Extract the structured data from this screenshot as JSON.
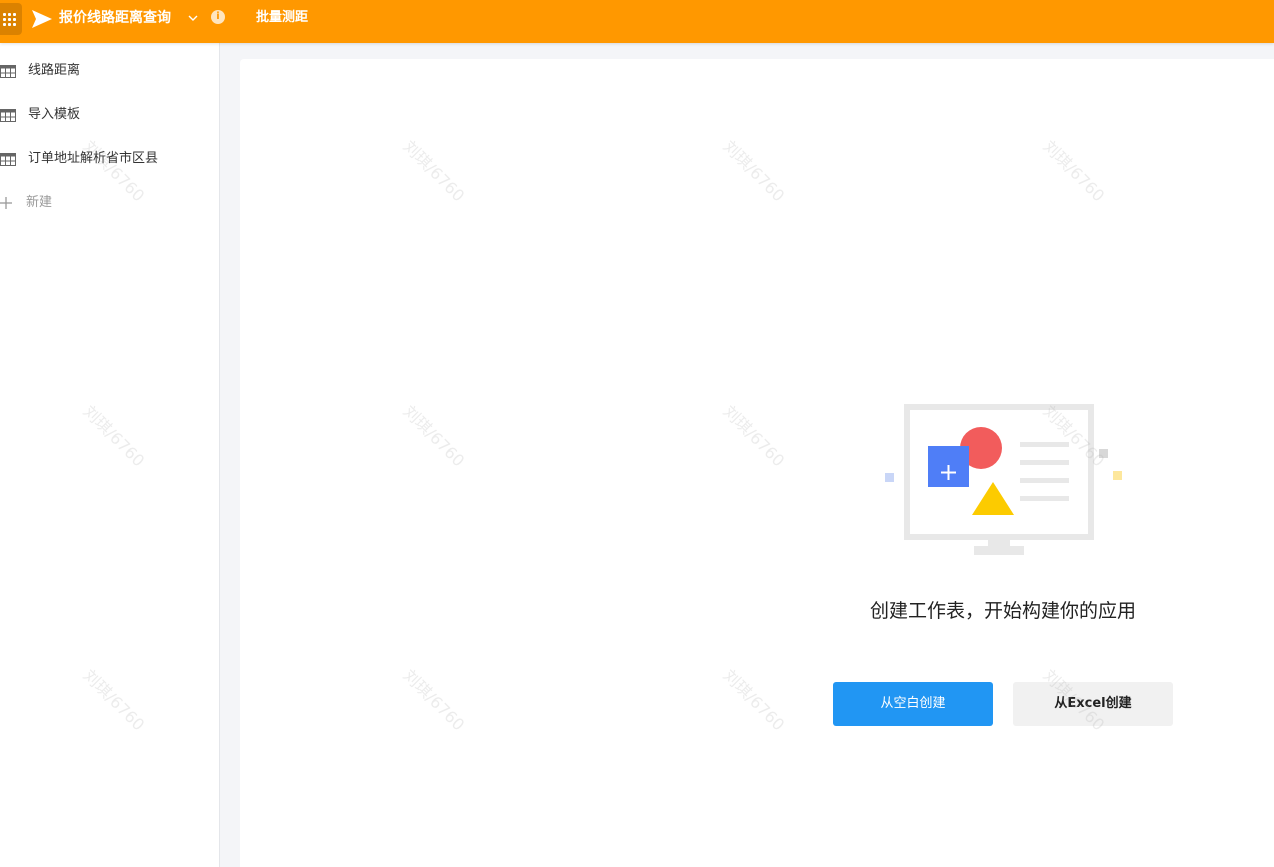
{
  "topbar": {
    "app_title": "报价线路距离查询",
    "info_glyph": "i",
    "nav_tab": "批量测距",
    "icons": {
      "apps": "grid-icon",
      "logo": "paper-plane-icon",
      "dropdown": "chevron-down-icon",
      "info": "info-icon"
    },
    "color": "#ff9800"
  },
  "sidebar": {
    "items": [
      {
        "label": "线路距离",
        "icon": "table-icon"
      },
      {
        "label": "导入模板",
        "icon": "table-icon"
      },
      {
        "label": "订单地址解析省市区县",
        "icon": "table-icon"
      }
    ],
    "new_label": "新建",
    "new_icon": "plus-icon"
  },
  "main": {
    "empty_message": "创建工作表，开始构建你的应用",
    "buttons": {
      "blank": "从空白创建",
      "excel": "从Excel创建"
    },
    "primary_color": "#2196f3"
  },
  "watermark": {
    "text": "刘琪/6760"
  }
}
